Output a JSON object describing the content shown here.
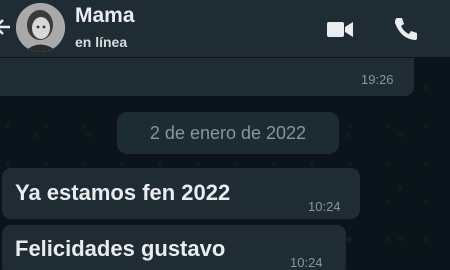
{
  "header": {
    "contact_name": "Mama",
    "status": "en línea",
    "icons": [
      "back-arrow-icon",
      "video-call-icon",
      "phone-call-icon"
    ]
  },
  "messages": {
    "previous_time": "19:26",
    "date_separator": "2 de enero de 2022",
    "items": [
      {
        "text": "Ya estamos fen 2022",
        "time": "10:24"
      },
      {
        "text": "Felicidades gustavo",
        "time": "10:24"
      }
    ]
  },
  "colors": {
    "chat_background": "#0b141a",
    "header_background": "#1f2c34",
    "bubble_background": "#1f2c34",
    "text_primary": "#e9edef",
    "text_secondary": "#8696a0"
  }
}
